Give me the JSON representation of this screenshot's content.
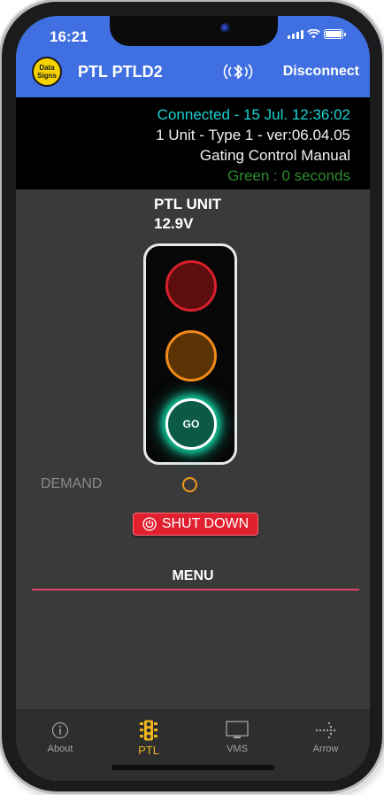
{
  "status_bar": {
    "time": "16:21"
  },
  "app_bar": {
    "logo_text_line1": "Data",
    "logo_text_line2": "Signs",
    "title": "PTL PTLD2",
    "disconnect_label": "Disconnect"
  },
  "info_panel": {
    "connection": "Connected - 15 Jul. 12:36:02",
    "unit_info": "1 Unit - Type 1 - ver:06.04.05",
    "mode": "Gating Control Manual",
    "state": "Green : 0 seconds"
  },
  "unit": {
    "name": "PTL UNIT",
    "voltage": "12.9V"
  },
  "signal": {
    "active_lamp": "green",
    "go_label": "GO"
  },
  "demand": {
    "label": "DEMAND"
  },
  "shutdown": {
    "label": "SHUT DOWN"
  },
  "menu": {
    "title": "MENU"
  },
  "tabs": [
    {
      "label": "About",
      "icon": "info-icon"
    },
    {
      "label": "PTL",
      "icon": "traffic-light-icon"
    },
    {
      "label": "VMS",
      "icon": "monitor-icon"
    },
    {
      "label": "Arrow",
      "icon": "arrow-board-icon"
    }
  ],
  "active_tab": "PTL",
  "colors": {
    "app_bar": "#3f6fe0",
    "connected_text": "#19d3d3",
    "state_text": "#2e8b2e",
    "shutdown": "#e0202f",
    "active_tab": "#f0b41e",
    "menu_underline": "#e0446a"
  }
}
